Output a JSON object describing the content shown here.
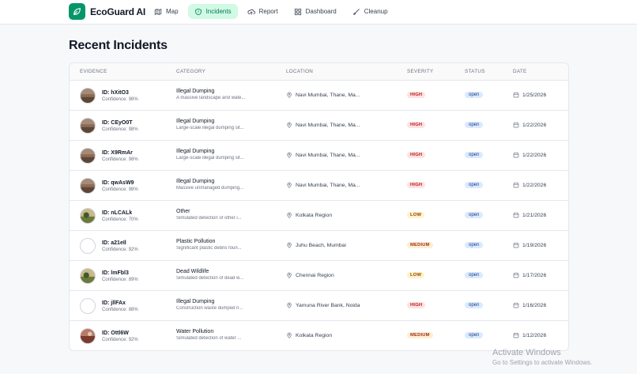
{
  "brand": {
    "name": "EcoGuard AI",
    "logo_icon": "leaf-icon",
    "accent": "#059669"
  },
  "nav": [
    {
      "label": "Map",
      "icon": "map-icon",
      "active": false
    },
    {
      "label": "Incidents",
      "icon": "shield-icon",
      "active": true
    },
    {
      "label": "Report",
      "icon": "upload-cloud-icon",
      "active": false
    },
    {
      "label": "Dashboard",
      "icon": "grid-icon",
      "active": false
    },
    {
      "label": "Cleanup",
      "icon": "brush-icon",
      "active": false
    }
  ],
  "page": {
    "title": "Recent Incidents"
  },
  "table": {
    "headers": {
      "evidence": "Evidence",
      "category": "Category",
      "location": "Location",
      "severity": "Severity",
      "status": "Status",
      "date": "Date"
    },
    "rows": [
      {
        "id": "ID: hXitO3",
        "confidence": "Confidence: 98%",
        "category": "Illegal Dumping",
        "description": "A massive landscape and wate...",
        "location": "Navi Mumbai, Thane, Ma...",
        "severity": "HIGH",
        "severity_level": "high",
        "status": "open",
        "date": "1/25/2026",
        "thumb": "photo"
      },
      {
        "id": "ID: CEyO0T",
        "confidence": "Confidence: 98%",
        "category": "Illegal Dumping",
        "description": "Large-scale illegal dumping sit...",
        "location": "Navi Mumbai, Thane, Ma...",
        "severity": "HIGH",
        "severity_level": "high",
        "status": "open",
        "date": "1/22/2026",
        "thumb": "photo"
      },
      {
        "id": "ID: X9RmAr",
        "confidence": "Confidence: 98%",
        "category": "Illegal Dumping",
        "description": "Large-scale illegal dumping sit...",
        "location": "Navi Mumbai, Thane, Ma...",
        "severity": "HIGH",
        "severity_level": "high",
        "status": "open",
        "date": "1/22/2026",
        "thumb": "photo"
      },
      {
        "id": "ID: qwAsW9",
        "confidence": "Confidence: 98%",
        "category": "Illegal Dumping",
        "description": "Massive unmanaged dumping...",
        "location": "Navi Mumbai, Thane, Ma...",
        "severity": "HIGH",
        "severity_level": "high",
        "status": "open",
        "date": "1/22/2026",
        "thumb": "photo"
      },
      {
        "id": "ID: nLCALk",
        "confidence": "Confidence: 70%",
        "category": "Other",
        "description": "Simulated detection of other i...",
        "location": "Kolkata Region",
        "severity": "LOW",
        "severity_level": "low",
        "status": "open",
        "date": "1/21/2026",
        "thumb": "photo-green"
      },
      {
        "id": "ID: a21eIl",
        "confidence": "Confidence: 92%",
        "category": "Plastic Pollution",
        "description": "Significant plastic debris foun...",
        "location": "Juhu Beach, Mumbai",
        "severity": "MEDIUM",
        "severity_level": "medium",
        "status": "open",
        "date": "1/19/2026",
        "thumb": "placeholder"
      },
      {
        "id": "ID: lmFbl3",
        "confidence": "Confidence: 89%",
        "category": "Dead Wildlife",
        "description": "Simulated detection of dead w...",
        "location": "Chennai Region",
        "severity": "LOW",
        "severity_level": "low",
        "status": "open",
        "date": "1/17/2026",
        "thumb": "photo-green"
      },
      {
        "id": "ID: jllFAx",
        "confidence": "Confidence: 88%",
        "category": "Illegal Dumping",
        "description": "Construction waste dumped n...",
        "location": "Yamuna River Bank, Noida",
        "severity": "HIGH",
        "severity_level": "high",
        "status": "open",
        "date": "1/16/2026",
        "thumb": "placeholder"
      },
      {
        "id": "ID: Ottl6W",
        "confidence": "Confidence: 92%",
        "category": "Water Pollution",
        "description": "Simulated detection of water ...",
        "location": "Kolkata Region",
        "severity": "MEDIUM",
        "severity_level": "medium",
        "status": "open",
        "date": "1/12/2026",
        "thumb": "photo-red"
      }
    ]
  },
  "watermark": {
    "title": "Activate Windows",
    "subtitle": "Go to Settings to activate Windows."
  }
}
